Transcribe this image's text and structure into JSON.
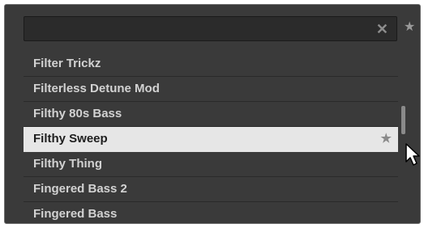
{
  "search": {
    "placeholder": "",
    "clear_icon": "✕",
    "favorites_icon": "★"
  },
  "list": {
    "items": [
      {
        "label": "Filter Trickz",
        "selected": false,
        "favorite": false
      },
      {
        "label": "Filterless Detune Mod",
        "selected": false,
        "favorite": false
      },
      {
        "label": "Filthy 80s Bass",
        "selected": false,
        "favorite": false
      },
      {
        "label": "Filthy Sweep",
        "selected": true,
        "favorite": true
      },
      {
        "label": "Filthy Thing",
        "selected": false,
        "favorite": false
      },
      {
        "label": "Fingered Bass 2",
        "selected": false,
        "favorite": false
      },
      {
        "label": "Fingered Bass",
        "selected": false,
        "favorite": false
      }
    ],
    "favorite_icon": "★"
  },
  "colors": {
    "panel_bg": "#3a3a3a",
    "selected_bg": "#e6e6e6",
    "text": "#d2d2d2"
  }
}
